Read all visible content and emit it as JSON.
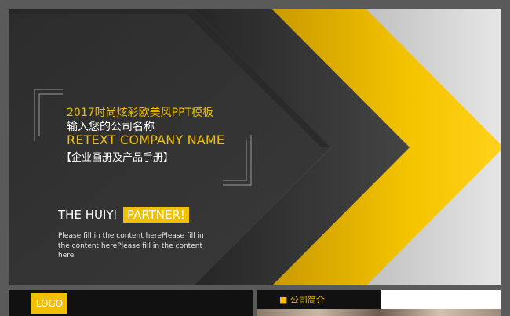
{
  "slide": {
    "tagline": "2017时尚炫彩欧美风PPT模板",
    "company_prompt": "输入您的公司名称",
    "retext": "RETEXT   COMPANY NAME",
    "brochure": "【企业画册及产品手册】",
    "the_huiyi": "THE  HUIYI",
    "partner": "PARTNER!",
    "description": "Please fill in the content herePlease fill in the content herePlease fill in the content here"
  },
  "thumbnails": {
    "logo": "LOGO",
    "company_intro": "■ 公司简介"
  },
  "colors": {
    "accent": "#f2c000",
    "background": "#2d2d2d",
    "frame": "#5a5a5a"
  }
}
